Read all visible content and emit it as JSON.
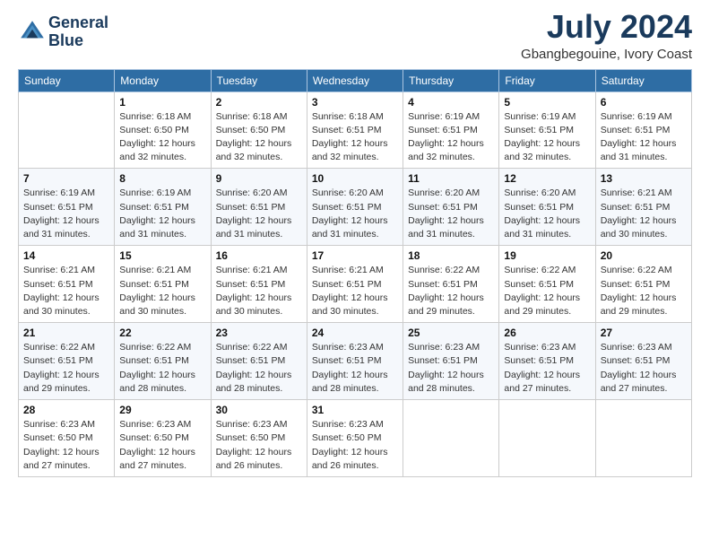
{
  "header": {
    "logo_line1": "General",
    "logo_line2": "Blue",
    "month_title": "July 2024",
    "location": "Gbangbegouine, Ivory Coast"
  },
  "weekdays": [
    "Sunday",
    "Monday",
    "Tuesday",
    "Wednesday",
    "Thursday",
    "Friday",
    "Saturday"
  ],
  "weeks": [
    [
      {
        "day": "",
        "detail": ""
      },
      {
        "day": "1",
        "detail": "Sunrise: 6:18 AM\nSunset: 6:50 PM\nDaylight: 12 hours\nand 32 minutes."
      },
      {
        "day": "2",
        "detail": "Sunrise: 6:18 AM\nSunset: 6:50 PM\nDaylight: 12 hours\nand 32 minutes."
      },
      {
        "day": "3",
        "detail": "Sunrise: 6:18 AM\nSunset: 6:51 PM\nDaylight: 12 hours\nand 32 minutes."
      },
      {
        "day": "4",
        "detail": "Sunrise: 6:19 AM\nSunset: 6:51 PM\nDaylight: 12 hours\nand 32 minutes."
      },
      {
        "day": "5",
        "detail": "Sunrise: 6:19 AM\nSunset: 6:51 PM\nDaylight: 12 hours\nand 32 minutes."
      },
      {
        "day": "6",
        "detail": "Sunrise: 6:19 AM\nSunset: 6:51 PM\nDaylight: 12 hours\nand 31 minutes."
      }
    ],
    [
      {
        "day": "7",
        "detail": "Sunrise: 6:19 AM\nSunset: 6:51 PM\nDaylight: 12 hours\nand 31 minutes."
      },
      {
        "day": "8",
        "detail": "Sunrise: 6:19 AM\nSunset: 6:51 PM\nDaylight: 12 hours\nand 31 minutes."
      },
      {
        "day": "9",
        "detail": "Sunrise: 6:20 AM\nSunset: 6:51 PM\nDaylight: 12 hours\nand 31 minutes."
      },
      {
        "day": "10",
        "detail": "Sunrise: 6:20 AM\nSunset: 6:51 PM\nDaylight: 12 hours\nand 31 minutes."
      },
      {
        "day": "11",
        "detail": "Sunrise: 6:20 AM\nSunset: 6:51 PM\nDaylight: 12 hours\nand 31 minutes."
      },
      {
        "day": "12",
        "detail": "Sunrise: 6:20 AM\nSunset: 6:51 PM\nDaylight: 12 hours\nand 31 minutes."
      },
      {
        "day": "13",
        "detail": "Sunrise: 6:21 AM\nSunset: 6:51 PM\nDaylight: 12 hours\nand 30 minutes."
      }
    ],
    [
      {
        "day": "14",
        "detail": "Sunrise: 6:21 AM\nSunset: 6:51 PM\nDaylight: 12 hours\nand 30 minutes."
      },
      {
        "day": "15",
        "detail": "Sunrise: 6:21 AM\nSunset: 6:51 PM\nDaylight: 12 hours\nand 30 minutes."
      },
      {
        "day": "16",
        "detail": "Sunrise: 6:21 AM\nSunset: 6:51 PM\nDaylight: 12 hours\nand 30 minutes."
      },
      {
        "day": "17",
        "detail": "Sunrise: 6:21 AM\nSunset: 6:51 PM\nDaylight: 12 hours\nand 30 minutes."
      },
      {
        "day": "18",
        "detail": "Sunrise: 6:22 AM\nSunset: 6:51 PM\nDaylight: 12 hours\nand 29 minutes."
      },
      {
        "day": "19",
        "detail": "Sunrise: 6:22 AM\nSunset: 6:51 PM\nDaylight: 12 hours\nand 29 minutes."
      },
      {
        "day": "20",
        "detail": "Sunrise: 6:22 AM\nSunset: 6:51 PM\nDaylight: 12 hours\nand 29 minutes."
      }
    ],
    [
      {
        "day": "21",
        "detail": "Sunrise: 6:22 AM\nSunset: 6:51 PM\nDaylight: 12 hours\nand 29 minutes."
      },
      {
        "day": "22",
        "detail": "Sunrise: 6:22 AM\nSunset: 6:51 PM\nDaylight: 12 hours\nand 28 minutes."
      },
      {
        "day": "23",
        "detail": "Sunrise: 6:22 AM\nSunset: 6:51 PM\nDaylight: 12 hours\nand 28 minutes."
      },
      {
        "day": "24",
        "detail": "Sunrise: 6:23 AM\nSunset: 6:51 PM\nDaylight: 12 hours\nand 28 minutes."
      },
      {
        "day": "25",
        "detail": "Sunrise: 6:23 AM\nSunset: 6:51 PM\nDaylight: 12 hours\nand 28 minutes."
      },
      {
        "day": "26",
        "detail": "Sunrise: 6:23 AM\nSunset: 6:51 PM\nDaylight: 12 hours\nand 27 minutes."
      },
      {
        "day": "27",
        "detail": "Sunrise: 6:23 AM\nSunset: 6:51 PM\nDaylight: 12 hours\nand 27 minutes."
      }
    ],
    [
      {
        "day": "28",
        "detail": "Sunrise: 6:23 AM\nSunset: 6:50 PM\nDaylight: 12 hours\nand 27 minutes."
      },
      {
        "day": "29",
        "detail": "Sunrise: 6:23 AM\nSunset: 6:50 PM\nDaylight: 12 hours\nand 27 minutes."
      },
      {
        "day": "30",
        "detail": "Sunrise: 6:23 AM\nSunset: 6:50 PM\nDaylight: 12 hours\nand 26 minutes."
      },
      {
        "day": "31",
        "detail": "Sunrise: 6:23 AM\nSunset: 6:50 PM\nDaylight: 12 hours\nand 26 minutes."
      },
      {
        "day": "",
        "detail": ""
      },
      {
        "day": "",
        "detail": ""
      },
      {
        "day": "",
        "detail": ""
      }
    ]
  ]
}
